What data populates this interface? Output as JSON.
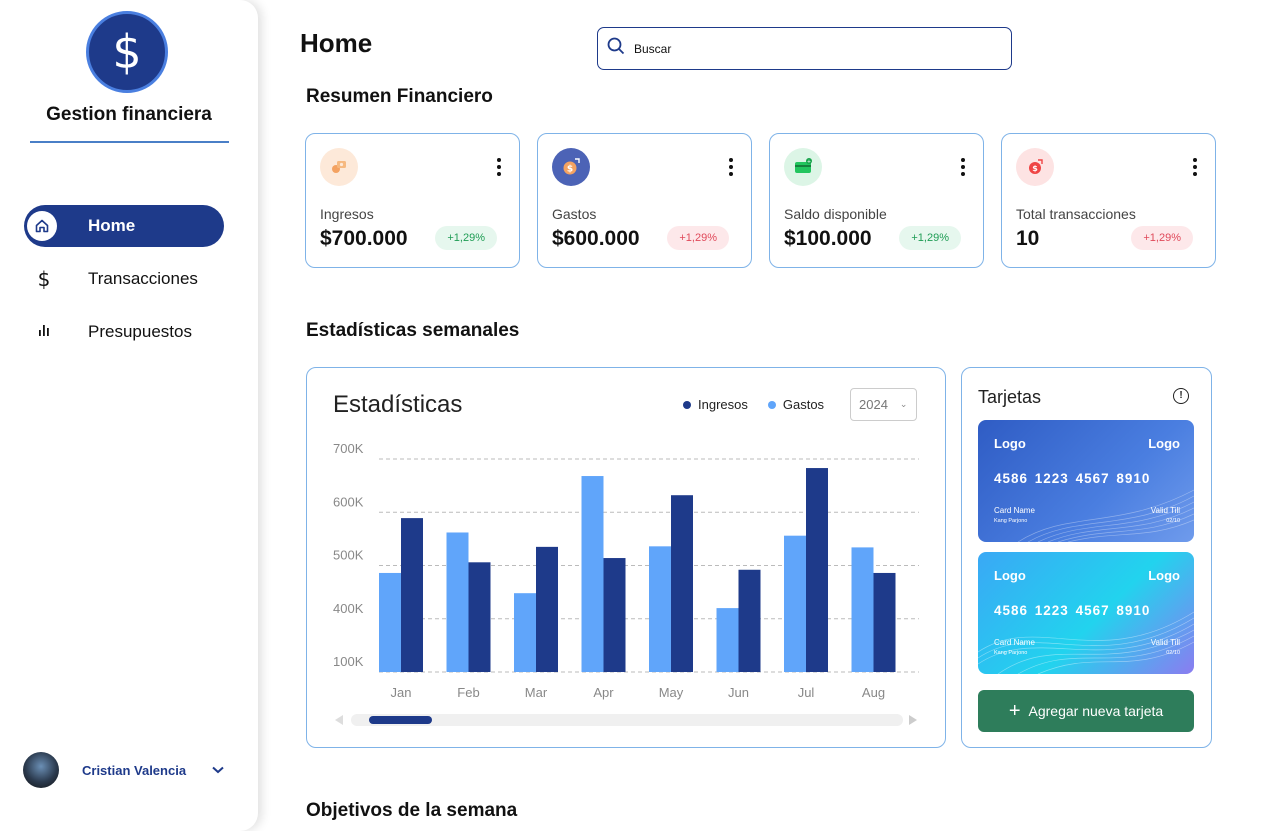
{
  "app": {
    "title": "Gestion financiera",
    "logo_symbol": "$"
  },
  "sidebar": {
    "items": [
      {
        "label": "Home",
        "icon": "home-icon",
        "active": true
      },
      {
        "label": "Transacciones",
        "icon": "dollar-icon",
        "active": false
      },
      {
        "label": "Presupuestos",
        "icon": "bar-chart-icon",
        "active": false
      }
    ],
    "user": {
      "name": "Cristian Valencia"
    }
  },
  "header": {
    "title": "Home",
    "search_placeholder": "Buscar"
  },
  "summary": {
    "title": "Resumen Financiero",
    "cards": [
      {
        "label": "Ingresos",
        "value": "$700.000",
        "badge": "+1,29%",
        "trend": "up",
        "icon": "income-icon",
        "icon_bg": "#fde9d9"
      },
      {
        "label": "Gastos",
        "value": "$600.000",
        "badge": "+1,29%",
        "trend": "down",
        "icon": "expense-icon",
        "icon_bg": "#4c63b6"
      },
      {
        "label": "Saldo disponible",
        "value": "$100.000",
        "badge": "+1,29%",
        "trend": "up",
        "icon": "wallet-icon",
        "icon_bg": "#dcf5e6"
      },
      {
        "label": "Total transacciones",
        "value": "10",
        "badge": "+1,29%",
        "trend": "down",
        "icon": "transactions-icon",
        "icon_bg": "#fde3e3"
      }
    ]
  },
  "weekly": {
    "title": "Estadísticas semanales",
    "chart_title": "Estadísticas",
    "legend": [
      "Ingresos",
      "Gastos"
    ],
    "year": "2024"
  },
  "chart_data": {
    "type": "bar",
    "title": "Estadísticas",
    "categories": [
      "Jan",
      "Feb",
      "Mar",
      "Apr",
      "May",
      "Jun",
      "Jul",
      "Aug"
    ],
    "y_ticks": [
      "700K",
      "600K",
      "500K",
      "400K",
      "100K"
    ],
    "tick_values": [
      700,
      600,
      500,
      400,
      300
    ],
    "ylim": [
      300,
      700
    ],
    "series": [
      {
        "name": "Gastos",
        "color": "#60a5fa",
        "values": [
          486,
          562,
          448,
          668,
          536,
          420,
          556,
          534
        ]
      },
      {
        "name": "Ingresos",
        "color": "#1e3a8a",
        "values": [
          589,
          506,
          535,
          514,
          632,
          492,
          683,
          486
        ]
      }
    ],
    "grid": "dashed horizontal",
    "legend_position": "top-right"
  },
  "cards_panel": {
    "title": "Tarjetas",
    "cards": [
      {
        "logo_left": "Logo",
        "logo_right": "Logo",
        "number": "4586 1223 4567 8910",
        "name_label": "Card Name",
        "name_value": "Kang Parjono",
        "valid_label": "Valid Till",
        "valid_value": "02/10"
      },
      {
        "logo_left": "Logo",
        "logo_right": "Logo",
        "number": "4586 1223 4567 8910",
        "name_label": "Card Name",
        "name_value": "Kang Parjono",
        "valid_label": "Valid Till",
        "valid_value": "02/10"
      }
    ],
    "add_label": "Agregar nueva tarjeta"
  },
  "goals": {
    "title": "Objetivos de la semana"
  }
}
